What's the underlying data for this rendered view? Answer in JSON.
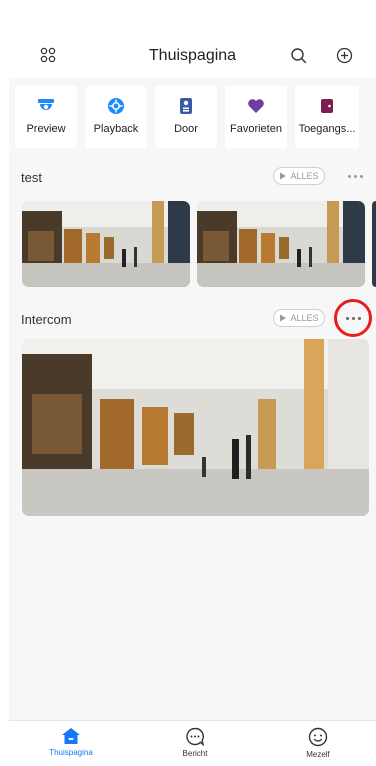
{
  "header": {
    "title": "Thuispagina",
    "left_icon": "grid-icon",
    "right_icons": [
      "search-icon",
      "add-icon"
    ]
  },
  "tiles": [
    {
      "label": "Preview",
      "icon": "camera-icon",
      "color": "#1e88ff"
    },
    {
      "label": "Playback",
      "icon": "playback-icon",
      "color": "#1e88ff"
    },
    {
      "label": "Door",
      "icon": "door-icon",
      "color": "#3a5aa8"
    },
    {
      "label": "Favorieten",
      "icon": "heart-icon",
      "color": "#6b3fa0"
    },
    {
      "label": "Toegangs...",
      "icon": "access-icon",
      "color": "#7a1f4f"
    }
  ],
  "sections": [
    {
      "title": "test",
      "all_label": "ALLES"
    },
    {
      "title": "Intercom",
      "all_label": "ALLES"
    }
  ],
  "tabbar": {
    "tabs": [
      {
        "label": "Thuispagina",
        "icon": "home-icon",
        "active": true
      },
      {
        "label": "Bericht",
        "icon": "message-icon",
        "active": false
      },
      {
        "label": "Mezelf",
        "icon": "profile-icon",
        "active": false
      }
    ],
    "active_color": "#1677ff"
  },
  "colors": {
    "highlight_ring": "#ea1b1b",
    "background": "#f7f7f8"
  }
}
